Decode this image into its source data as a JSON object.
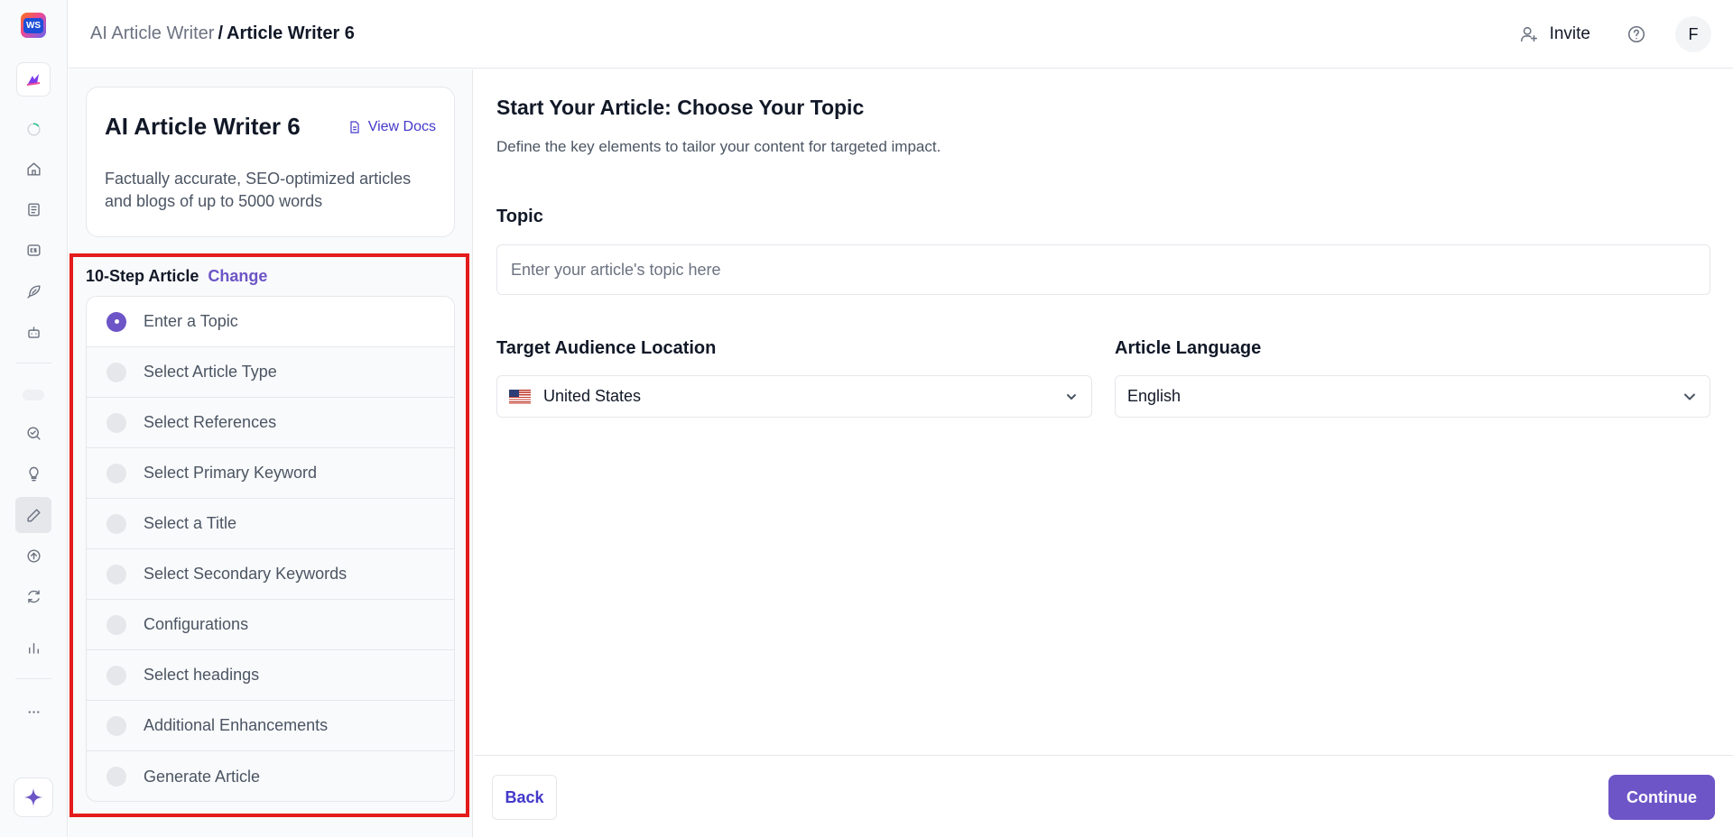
{
  "rail": {
    "logo_text": "WS",
    "icons": [
      "loading-icon",
      "home-icon",
      "articles-icon",
      "cs-icon",
      "feather-icon",
      "bot-icon",
      "search-check-icon",
      "lightbulb-icon",
      "pencil-icon",
      "upload-icon",
      "refresh-icon",
      "bar-chart-icon",
      "more-icon",
      "sparkle-icon"
    ]
  },
  "breadcrumb": {
    "root": "AI Article Writer",
    "separator": "/",
    "current": "Article Writer 6"
  },
  "header": {
    "invite_label": "Invite",
    "avatar_initial": "F"
  },
  "tool": {
    "title": "AI Article Writer 6",
    "docs_label": "View Docs",
    "description": "Factually accurate, SEO-optimized articles and blogs of up to 5000 words"
  },
  "steps": {
    "label": "10-Step Article",
    "change_label": "Change",
    "items": [
      "Enter a Topic",
      "Select Article Type",
      "Select References",
      "Select Primary Keyword",
      "Select a Title",
      "Select Secondary Keywords",
      "Configurations",
      "Select headings",
      "Additional Enhancements",
      "Generate Article"
    ],
    "current_index": 0
  },
  "main": {
    "heading": "Start Your Article: Choose Your Topic",
    "subheading": "Define the key elements to tailor your content for targeted impact.",
    "topic_label": "Topic",
    "topic_placeholder": "Enter your article's topic here",
    "topic_value": "",
    "location_label": "Target Audience Location",
    "location_value": "United States",
    "language_label": "Article Language",
    "language_value": "English"
  },
  "footer": {
    "back_label": "Back",
    "continue_label": "Continue"
  },
  "colors": {
    "accent": "#6d55c7",
    "link": "#4338ca",
    "highlight_border": "#e31b1b"
  }
}
